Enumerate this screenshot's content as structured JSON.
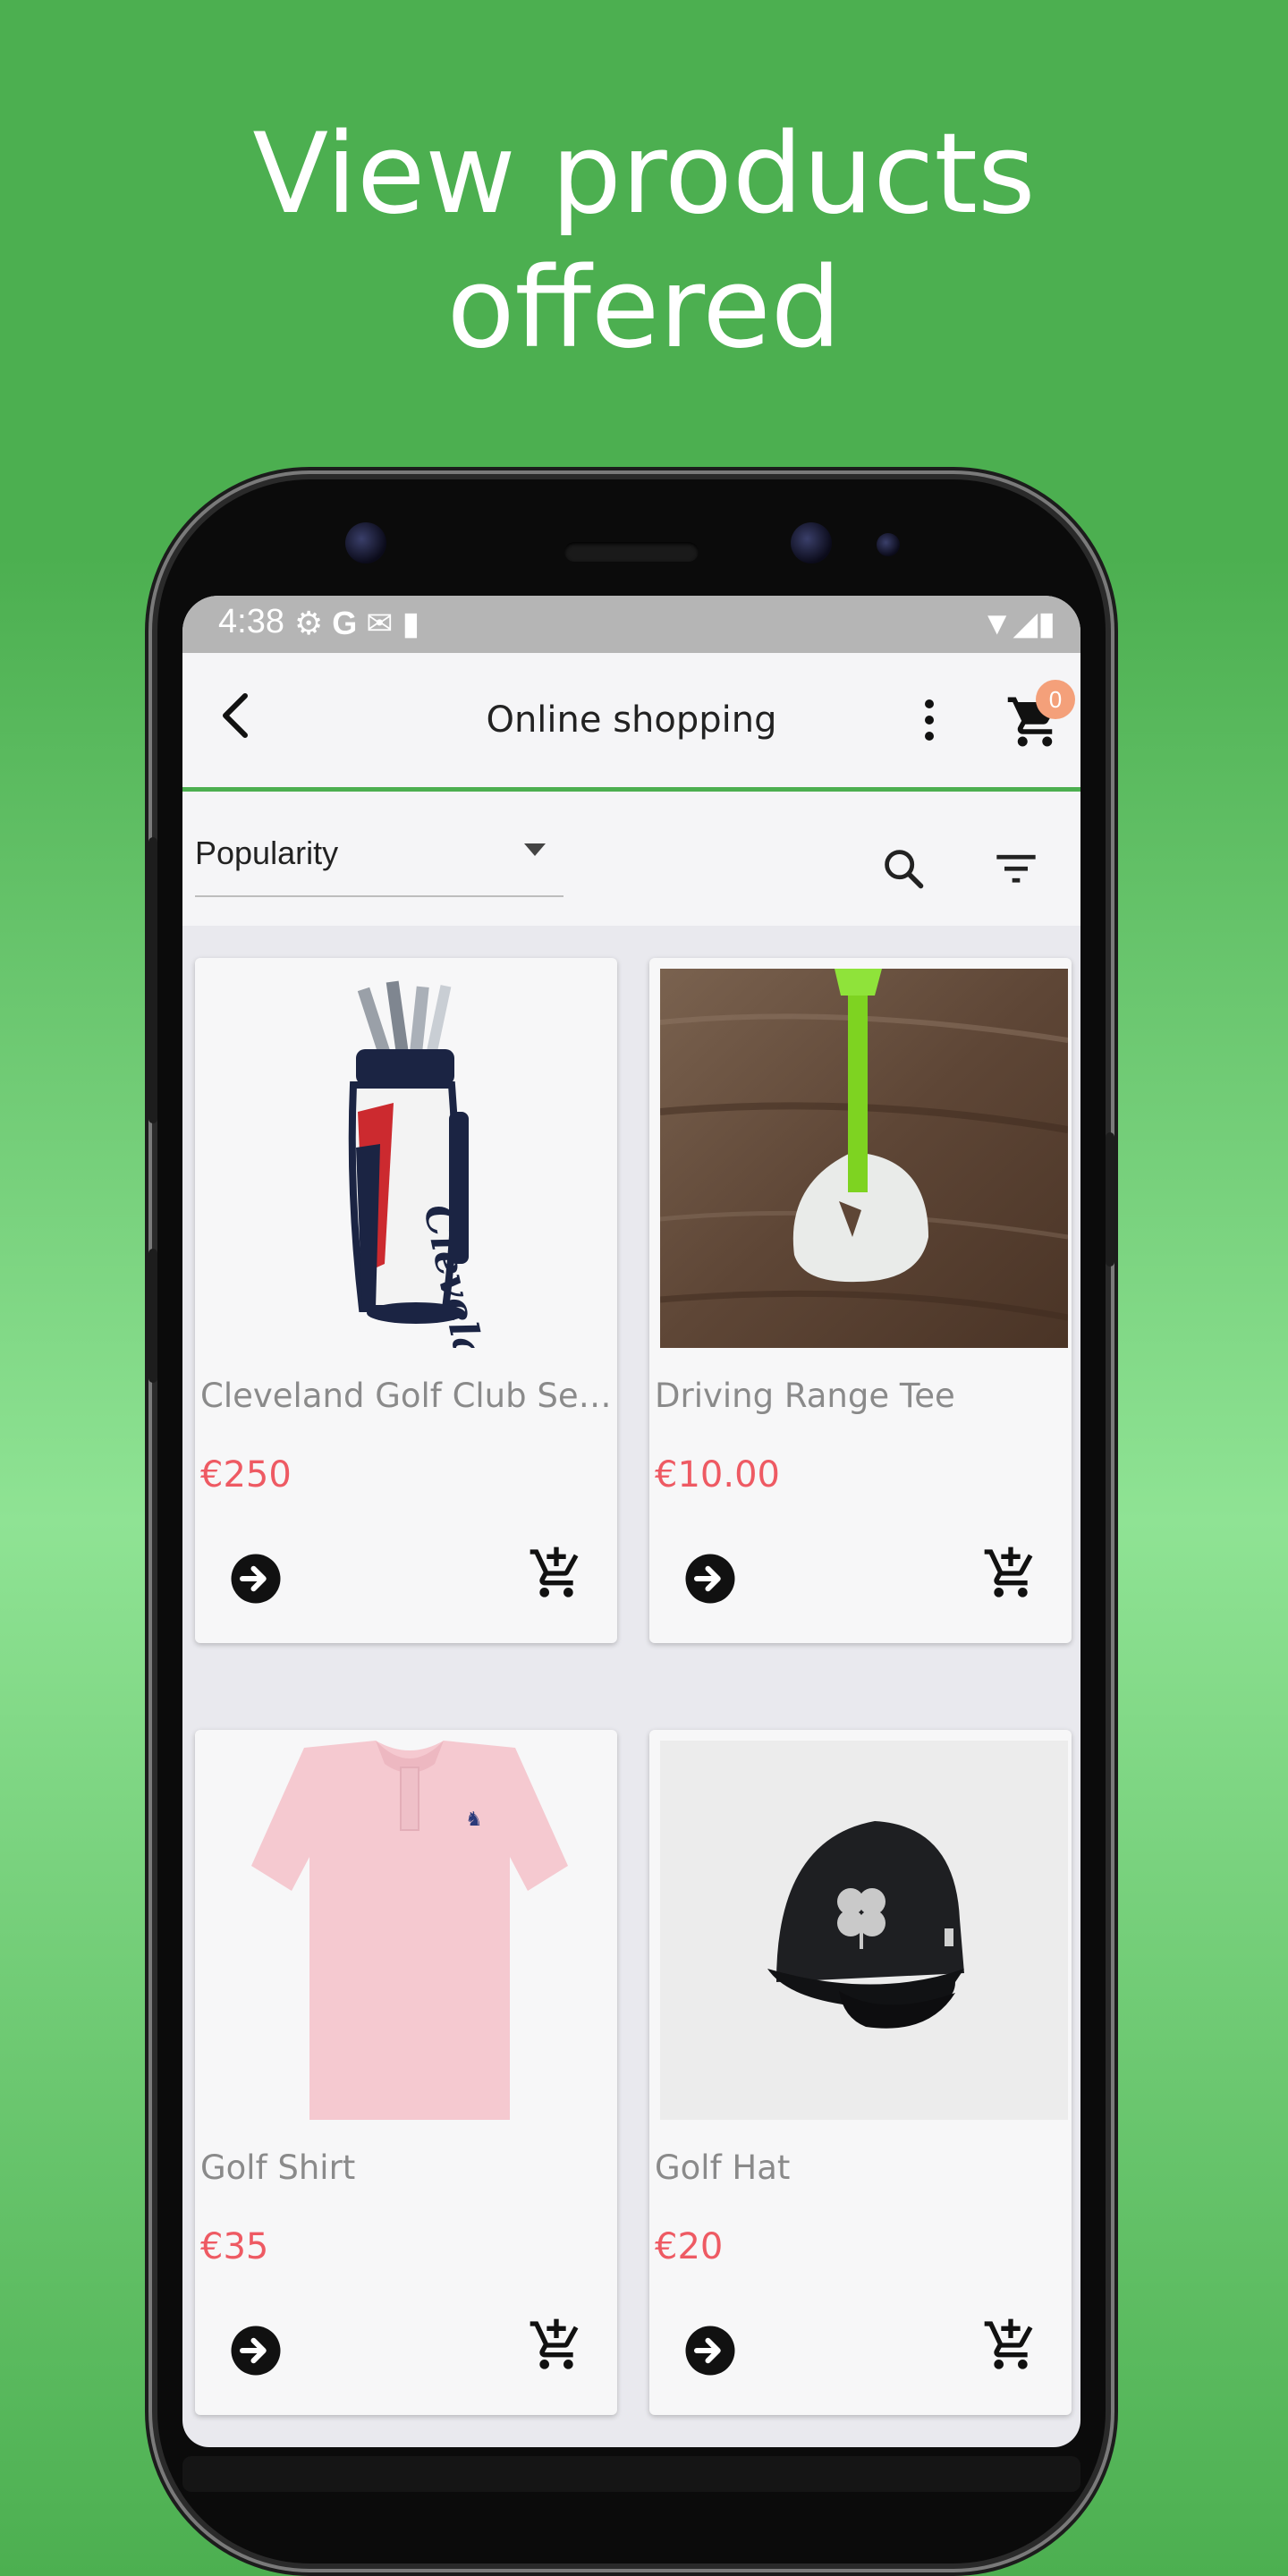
{
  "headline": {
    "line1": "View products",
    "line2": "offered"
  },
  "statusbar": {
    "time": "4:38",
    "icons": [
      "gear-icon",
      "google-icon",
      "gmail-icon",
      "sd-card-icon"
    ],
    "right_icons": [
      "wifi-icon",
      "signal-icon",
      "battery-icon"
    ]
  },
  "appbar": {
    "title": "Online shopping",
    "cart_count": "0"
  },
  "filterbar": {
    "sort_value": "Popularity"
  },
  "products": [
    {
      "name": "Cleveland Golf Club Set ...",
      "price": "€250"
    },
    {
      "name": "Driving Range Tee",
      "price": "€10.00"
    },
    {
      "name": "Golf Shirt",
      "price": "€35"
    },
    {
      "name": "Golf Hat",
      "price": "€20"
    }
  ],
  "colors": {
    "brand_green": "#4caf50",
    "price_red": "#ee5a63",
    "badge_orange": "#f4a07a"
  }
}
